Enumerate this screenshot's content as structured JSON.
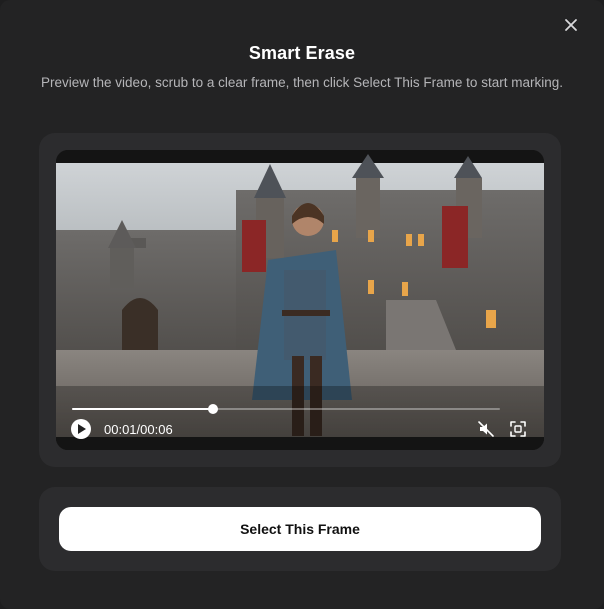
{
  "dialog": {
    "title": "Smart Erase",
    "subtitle": "Preview the video, scrub to a clear frame, then click Select This Frame to start marking.",
    "close_icon": "close-icon"
  },
  "player": {
    "time_display": "00:01/00:06",
    "progress": 0.33,
    "muted": true,
    "play_icon": "play-icon",
    "mute_icon": "mute-icon",
    "fullscreen_icon": "fullscreen-icon"
  },
  "actions": {
    "select_frame_label": "Select This Frame"
  }
}
